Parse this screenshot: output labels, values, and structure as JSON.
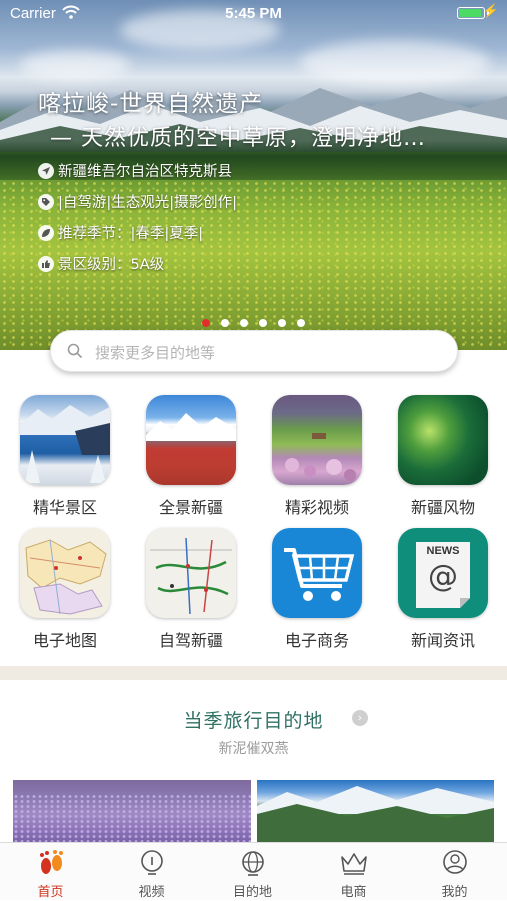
{
  "status_bar": {
    "carrier": "Carrier",
    "time": "5:45 PM"
  },
  "hero": {
    "title": "喀拉峻-世界自然遗产",
    "subtitle": "— 天然优质的空中草原，澄明净地…",
    "info": [
      {
        "icon": "location-icon",
        "text": "新疆维吾尔自治区特克斯县"
      },
      {
        "icon": "tag-icon",
        "text": "|自驾游|生态观光|摄影创作|"
      },
      {
        "icon": "leaf-icon",
        "text": "推荐季节：|春季|夏季|"
      },
      {
        "icon": "thumb-up-icon",
        "text": "景区级别：5A级"
      }
    ],
    "carousel_count": 6,
    "carousel_active": 1
  },
  "search": {
    "placeholder": "搜索更多目的地等"
  },
  "grid": [
    {
      "label": "精华景区",
      "icon": "scenic-photo"
    },
    {
      "label": "全景新疆",
      "icon": "panorama-photo"
    },
    {
      "label": "精彩视频",
      "icon": "video-photo"
    },
    {
      "label": "新疆风物",
      "icon": "products-photo"
    },
    {
      "label": "电子地图",
      "icon": "map-icon"
    },
    {
      "label": "自驾新疆",
      "icon": "route-map-icon"
    },
    {
      "label": "电子商务",
      "icon": "shopping-cart-icon"
    },
    {
      "label": "新闻资讯",
      "icon": "news-icon"
    }
  ],
  "news_badge": "NEWS",
  "section": {
    "title": "当季旅行目的地",
    "subtitle": "新泥催双燕"
  },
  "tabbar": [
    {
      "label": "首页",
      "icon": "home-footprint-icon",
      "active": true
    },
    {
      "label": "视频",
      "icon": "lightbulb-icon",
      "active": false
    },
    {
      "label": "目的地",
      "icon": "globe-icon",
      "active": false
    },
    {
      "label": "电商",
      "icon": "crown-icon",
      "active": false
    },
    {
      "label": "我的",
      "icon": "user-icon",
      "active": false
    }
  ],
  "colors": {
    "accent": "#d2321f",
    "section_title": "#2f7163",
    "carousel_active": "#e0302c"
  }
}
